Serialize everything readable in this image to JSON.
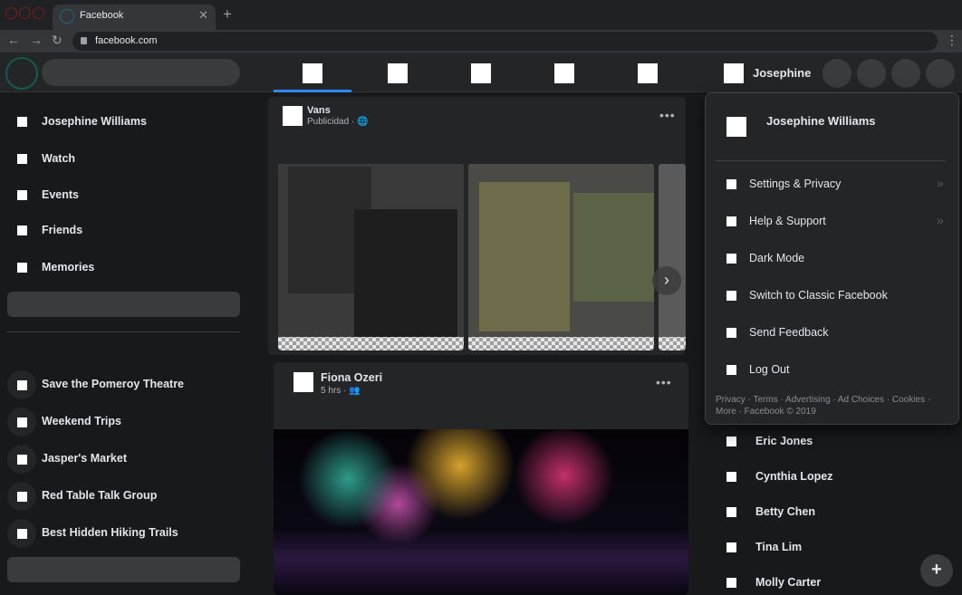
{
  "browser": {
    "tab_title": "Facebook",
    "tab_close": "✕",
    "new_tab": "+",
    "url": "facebook.com",
    "back": "←",
    "forward": "→",
    "reload": "↻",
    "menu": "⋮"
  },
  "top_nav": {
    "profile_name": "Josephine"
  },
  "sidebar": {
    "items": [
      {
        "label": "Josephine Williams"
      },
      {
        "label": "Watch"
      },
      {
        "label": "Events"
      },
      {
        "label": "Friends"
      },
      {
        "label": "Memories"
      }
    ],
    "shortcuts": [
      {
        "label": "Save the Pomeroy Theatre"
      },
      {
        "label": "Weekend Trips"
      },
      {
        "label": "Jasper's Market"
      },
      {
        "label": "Red Table Talk Group"
      },
      {
        "label": "Best Hidden Hiking Trails"
      }
    ]
  },
  "feed": {
    "posts": [
      {
        "author": "Vans",
        "meta": "Publicidad · 🌐",
        "more": "•••"
      },
      {
        "author": "Fiona Ozeri",
        "meta": "5 hrs · 👥",
        "more": "•••"
      }
    ],
    "carousel_next": "›"
  },
  "account_menu": {
    "name": "Josephine Williams",
    "items": [
      {
        "label": "Settings & Privacy",
        "chevron": "»"
      },
      {
        "label": "Help & Support",
        "chevron": "»"
      },
      {
        "label": "Dark Mode",
        "chevron": ""
      },
      {
        "label": "Switch to Classic Facebook",
        "chevron": ""
      },
      {
        "label": "Send Feedback",
        "chevron": ""
      },
      {
        "label": "Log Out",
        "chevron": ""
      }
    ],
    "footer": "Privacy · Terms · Advertising · Ad Choices · Cookies · More · Facebook © 2019"
  },
  "contacts": [
    {
      "name": "Eric Jones"
    },
    {
      "name": "Cynthia Lopez"
    },
    {
      "name": "Betty Chen"
    },
    {
      "name": "Tina Lim"
    },
    {
      "name": "Molly Carter"
    }
  ],
  "new_message": "+",
  "colors": {
    "accent": "#2d88ff",
    "background": "#18191a",
    "surface": "#242526"
  }
}
